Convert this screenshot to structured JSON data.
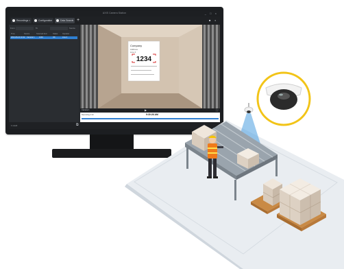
{
  "monitor": {
    "app_title": "AXIS Camera Station",
    "window_buttons": [
      "_",
      "□",
      "×"
    ],
    "tabs": [
      {
        "label": "Recordings",
        "active": false,
        "has_close": true
      },
      {
        "label": "Configuration",
        "active": false,
        "has_close": false
      },
      {
        "label": "Data Search",
        "active": true,
        "has_close": true
      }
    ],
    "add_tab": "+",
    "top_controls": [
      "■",
      "◑"
    ],
    "filters": {
      "from_label": "From",
      "to_label": "To",
      "source_label": "Source"
    },
    "grid": {
      "columns": [
        "Time",
        "Source",
        "Scanned item",
        "Status",
        "Operator"
      ],
      "rows": [
        {
          "time": "2021-06-21 10:42",
          "source": "Camera 1",
          "item": "1234",
          "status": "OK",
          "operator": "Line 4"
        }
      ]
    },
    "video": {
      "package_label_lines": [
        "Company",
        "Address",
        "Line 2"
      ],
      "package_code": "1234",
      "accent_color": "#d72e2e"
    },
    "controls": {
      "camera_label": "Camera 1",
      "play": "▶",
      "fullscreen": "⛶"
    },
    "timeline": {
      "label": "Recording 4:13",
      "time": "9:30:26 AM"
    },
    "status": {
      "left": "1 result",
      "icon": "⧉"
    }
  },
  "scene": {
    "camera_ring_color": "#f2c418",
    "conveyor_color": "#9aa4ad",
    "beam_color": "#4a9fe0",
    "worker_vest_color": "#f07a1a",
    "box_color": "#e2d8cc",
    "pallet_color": "#c98a45"
  }
}
